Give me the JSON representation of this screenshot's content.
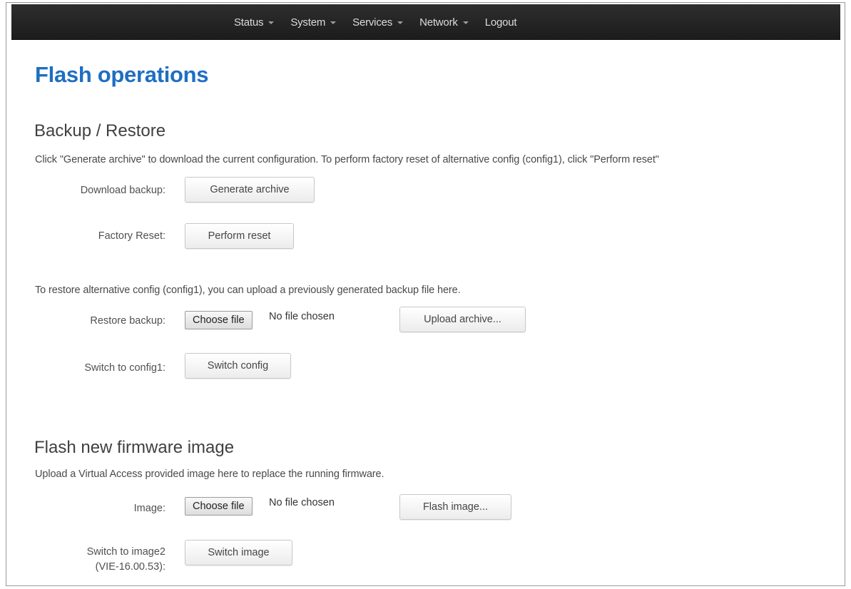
{
  "nav": {
    "items": [
      {
        "label": "Status",
        "dropdown": true
      },
      {
        "label": "System",
        "dropdown": true
      },
      {
        "label": "Services",
        "dropdown": true
      },
      {
        "label": "Network",
        "dropdown": true
      },
      {
        "label": "Logout",
        "dropdown": false
      }
    ]
  },
  "page": {
    "title": "Flash operations"
  },
  "backup": {
    "title": "Backup / Restore",
    "description": "Click \"Generate archive\" to download the current configuration. To perform factory reset of alternative config (config1), click \"Perform reset\"",
    "download_label": "Download backup:",
    "download_button": "Generate archive",
    "reset_label": "Factory Reset:",
    "reset_button": "Perform reset",
    "restore_description": "To restore alternative config (config1), you can upload a previously generated backup file here.",
    "restore_label": "Restore backup:",
    "restore_choose_button": "Choose file",
    "restore_file_status": "No file chosen",
    "upload_button": "Upload archive...",
    "switch_label": "Switch to config1:",
    "switch_button": "Switch config"
  },
  "firmware": {
    "title": "Flash new firmware image",
    "description": "Upload a Virtual Access provided image here to replace the running firmware.",
    "image_label": "Image:",
    "image_choose_button": "Choose file",
    "image_file_status": "No file chosen",
    "flash_button": "Flash image...",
    "switch_label_line1": "Switch to image2",
    "switch_label_line2": "(VIE-16.00.53):",
    "switch_button": "Switch image"
  },
  "colors": {
    "navbar": "#232323",
    "title_blue": "#1f6ec2"
  }
}
